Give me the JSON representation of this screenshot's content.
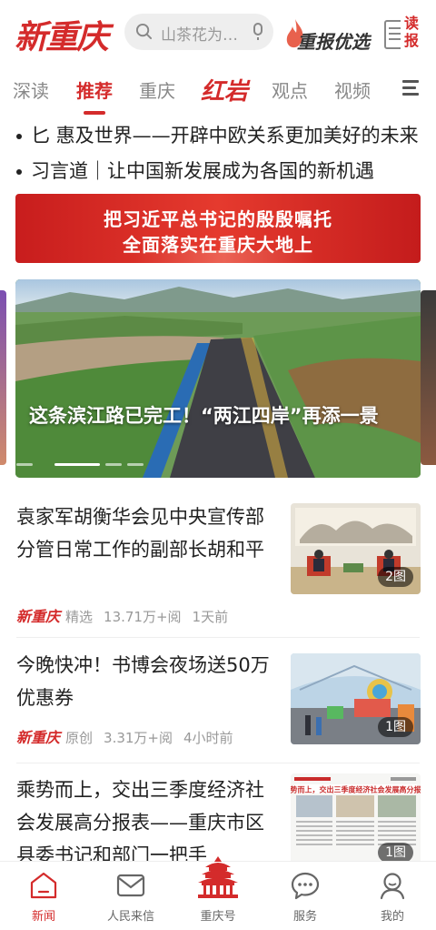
{
  "header": {
    "logo": "新重庆",
    "search_placeholder": "山茶花为…",
    "youxuan": "重报优选",
    "dubao": [
      "读",
      "报"
    ]
  },
  "tabs": [
    {
      "label": "深读",
      "active": false
    },
    {
      "label": "推荐",
      "active": true
    },
    {
      "label": "重庆",
      "active": false
    },
    {
      "label": "红岩",
      "active": false
    },
    {
      "label": "观点",
      "active": false
    },
    {
      "label": "视频",
      "active": false
    }
  ],
  "ticker": [
    "匕 惠及世界——开辟中欧关系更加美好的未来",
    "习言道｜让中国新发展成为各国的新机遇"
  ],
  "banner": {
    "line1": "把习近平总书记的殷殷嘱托",
    "line2": "全面落实在重庆大地上"
  },
  "hero": {
    "caption": "这条滨江路已完工！“两江四岸”再添一景"
  },
  "news": [
    {
      "title": "袁家军胡衡华会见中央宣传部分管日常工作的副部长胡和平",
      "source": "新重庆",
      "tag": "精选",
      "reads": "13.71万+阅",
      "time": "1天前",
      "img_count": "2图"
    },
    {
      "title": "今晚快冲！书博会夜场送50万优惠券",
      "source": "新重庆",
      "tag": "原创",
      "reads": "3.31万+阅",
      "time": "4小时前",
      "img_count": "1图"
    },
    {
      "title": "乘势而上，交出三季度经济社会发展高分报表——重庆市区县委书记和部门一把手",
      "img_count": "1图",
      "thumb_headline": "乘势而上，交出三季度经济社会发展高分报表"
    }
  ],
  "bottom_nav": [
    {
      "label": "新闻",
      "icon": "home-icon",
      "active": true
    },
    {
      "label": "人民来信",
      "icon": "mail-icon",
      "active": false
    },
    {
      "label": "重庆号",
      "icon": "pavilion-icon",
      "active": false
    },
    {
      "label": "服务",
      "icon": "chat-bubble-icon",
      "active": false
    },
    {
      "label": "我的",
      "icon": "user-icon",
      "active": false
    }
  ],
  "colors": {
    "accent": "#d42b2b",
    "text": "#222222",
    "muted": "#999999"
  }
}
